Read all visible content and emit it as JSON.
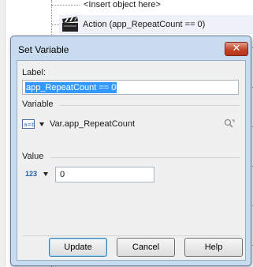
{
  "background": {
    "insert_placeholder": "<Insert object here>",
    "action_label": "Action (app_RepeatCount == 0)"
  },
  "dialog": {
    "title": "Set Variable",
    "close_glyph": "✕",
    "label_caption": "Label:",
    "label_value": "app_RepeatCount == 0",
    "variable_section": "Variable",
    "variable_type_icon": "variable-type-icon",
    "variable_value": "Var.app_RepeatCount",
    "value_section": "Value",
    "value_type_text": "123",
    "value_input": "0",
    "buttons": {
      "update": "Update",
      "cancel": "Cancel",
      "help": "Help"
    }
  },
  "colors": {
    "titlebar": "#c9dbee",
    "client": "#f0f0f0",
    "selection": "#3399ff",
    "close": "#c6432b",
    "accent_text": "#1f5fa8"
  }
}
